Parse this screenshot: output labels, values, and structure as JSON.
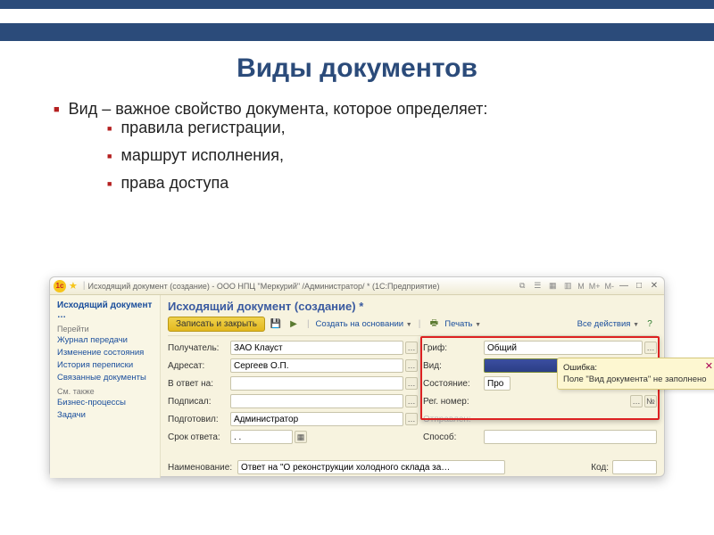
{
  "slide": {
    "title": "Виды документов",
    "lead": "Вид – важное свойство документа, которое определяет:",
    "sub": [
      "правила регистрации,",
      "маршрут исполнения,",
      "права доступа"
    ]
  },
  "window": {
    "title": "Исходящий документ (создание) - ООО НПЦ \"Меркурий\" /Администратор/ * (1С:Предприятие)",
    "sizes": [
      "M",
      "M+",
      "M-"
    ]
  },
  "sidebar": {
    "head": "Исходящий документ …",
    "goto": "Перейти",
    "links": [
      "Журнал передачи",
      "Изменение состояния",
      "История переписки",
      "Связанные документы"
    ],
    "see_also": "См. также",
    "links2": [
      "Бизнес-процессы",
      "Задачи"
    ]
  },
  "doc": {
    "title": "Исходящий документ (создание) *"
  },
  "toolbar": {
    "save_close": "Записать и закрыть",
    "create_based": "Создать на основании",
    "print": "Печать",
    "all_actions": "Все действия"
  },
  "left_fields": {
    "recipient_l": "Получатель:",
    "recipient_v": "ЗАО Клауст",
    "addressee_l": "Адресат:",
    "addressee_v": "Сергеев О.П.",
    "reply_l": "В ответ на:",
    "signed_l": "Подписал:",
    "prepared_l": "Подготовил:",
    "prepared_v": "Администратор",
    "deadline_l": "Срок ответа:",
    "deadline_v": ". .",
    "name_l": "Наименование:",
    "name_v": "Ответ на \"О реконструкции холодного склада за…"
  },
  "right_fields": {
    "grif_l": "Гриф:",
    "grif_v": "Общий",
    "vid_l": "Вид:",
    "state_l": "Состояние:",
    "state_v": "Про",
    "regnum_l": "Рег. номер:",
    "sent_l": "Отправлен:",
    "method_l": "Способ:",
    "kod_l": "Код:",
    "num_btn": "№"
  },
  "tooltip": {
    "title": "Ошибка:",
    "body": "Поле \"Вид документа\" не заполнено"
  }
}
